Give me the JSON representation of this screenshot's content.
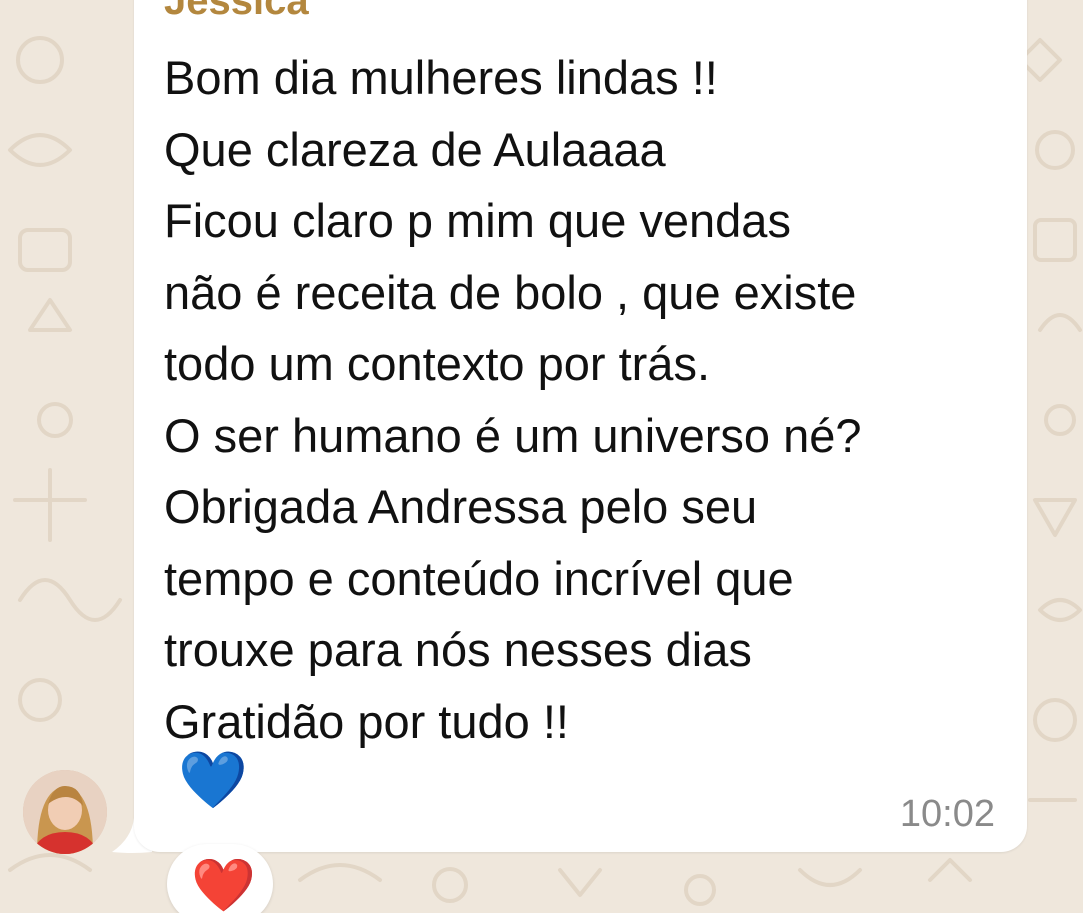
{
  "message": {
    "sender": "Jessica",
    "lines": [
      "Bom dia mulheres lindas !!",
      "Que clareza de Aulaaaa",
      "Ficou claro p mim que vendas",
      "não é receita de bolo , que existe",
      "todo um contexto por trás.",
      "O ser humano é um universo né?",
      "Obrigada Andressa pelo seu",
      "tempo e conteúdo incrível que",
      "trouxe para nós nesses dias",
      "Gratidão por tudo !!"
    ],
    "emoji": "💙",
    "time": "10:02"
  },
  "reaction": {
    "emoji": "❤️"
  },
  "colors": {
    "wallpaper": "#efe7dc",
    "bubble": "#ffffff",
    "sender_name": "#b3873e",
    "timestamp": "#8a8a8a"
  },
  "icons": {
    "avatar": "user-avatar-photo",
    "reaction": "red-heart-icon",
    "message_emoji": "blue-heart-icon"
  }
}
